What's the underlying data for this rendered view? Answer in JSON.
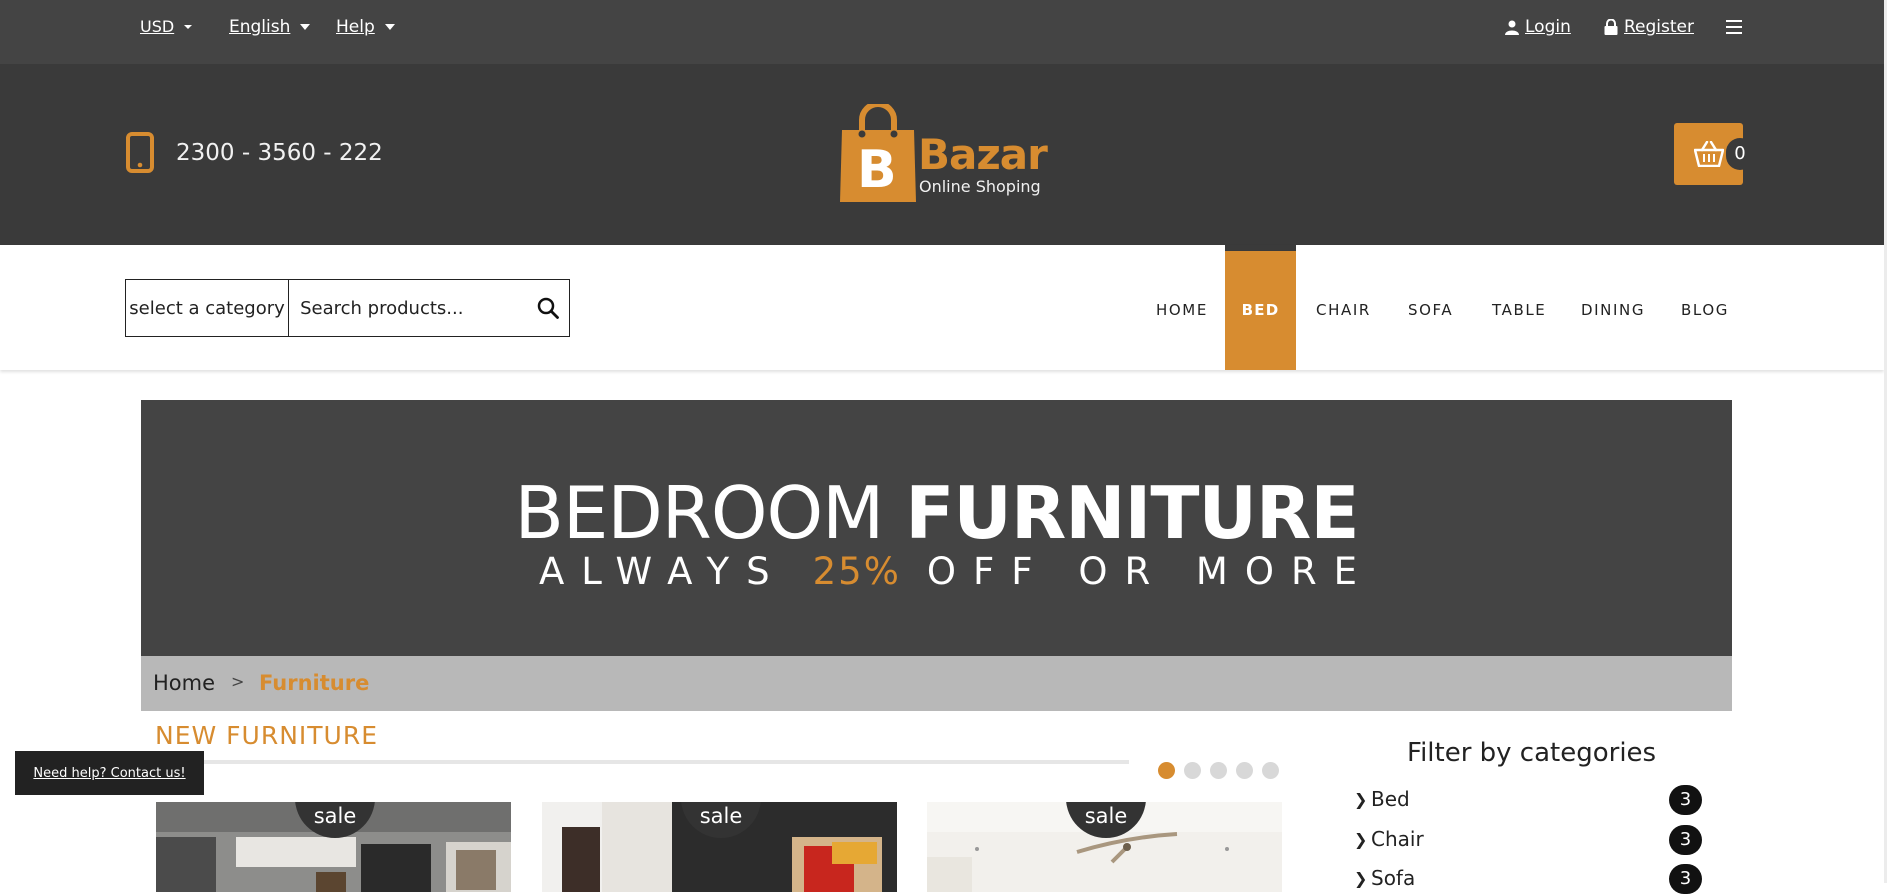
{
  "topbar": {
    "currency": "USD",
    "language": "English",
    "help": "Help",
    "login": "Login",
    "register": "Register"
  },
  "header": {
    "phone": "2300 - 3560 - 222",
    "logo_letter": "B",
    "logo_word": "Bazar",
    "logo_sub": "Online Shoping",
    "cart_count": "0"
  },
  "search": {
    "category": "select a category",
    "placeholder": "Search products..."
  },
  "nav": {
    "items": [
      "HOME",
      "BED",
      "CHAIR",
      "SOFA",
      "TABLE",
      "DINING",
      "BLOG"
    ],
    "active": "BED"
  },
  "banner": {
    "title_light": "BEDROOM",
    "title_bold": "FURNITURE",
    "sub_pre": "ALWAYS",
    "sub_pct": "25%",
    "sub_post": "OFF OR MORE"
  },
  "breadcrumb": {
    "home": "Home",
    "separator": ">",
    "current": "Furniture"
  },
  "section": {
    "title": "NEW FURNITURE",
    "progress": 0.05,
    "slides": 5,
    "active_slide": 1
  },
  "help": {
    "label": "Need help? Contact us!"
  },
  "products": [
    {
      "badge": "sale"
    },
    {
      "badge": "sale"
    },
    {
      "badge": "sale"
    }
  ],
  "filters": {
    "title": "Filter by categories",
    "items": [
      {
        "label": "Bed",
        "count": "3"
      },
      {
        "label": "Chair",
        "count": "3"
      },
      {
        "label": "Sofa",
        "count": "3"
      }
    ]
  },
  "colors": {
    "accent": "#d78c30",
    "dark": "#3a3a3a",
    "topbar": "#444444"
  }
}
